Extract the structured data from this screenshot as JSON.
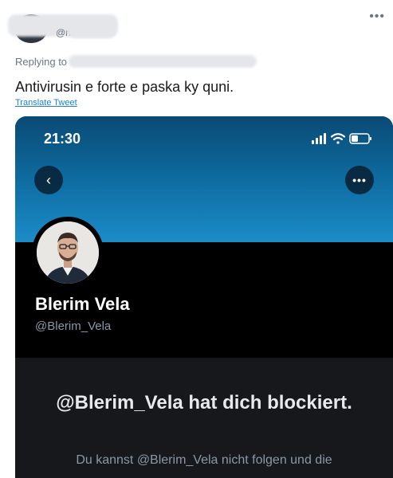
{
  "tweet": {
    "handle_partial": "@n",
    "replying_prefix": "Replying to",
    "text": "Antivirusin e forte e paska ky quni.",
    "translate_label": "Translate Tweet",
    "more_icon": "more-horizontal-icon"
  },
  "phone": {
    "time": "21:30",
    "status_icons": [
      "cellular-signal-icon",
      "wifi-icon",
      "battery-icon"
    ],
    "back_icon": "chevron-left-icon",
    "more_icon": "more-horizontal-icon",
    "banner_color": "#1c8cc8"
  },
  "profile": {
    "name": "Blerim Vela",
    "handle": "@Blerim_Vela"
  },
  "blocked": {
    "title": "@Blerim_Vela hat dich blockiert.",
    "body": "Du kannst @Blerim_Vela nicht folgen und die"
  }
}
